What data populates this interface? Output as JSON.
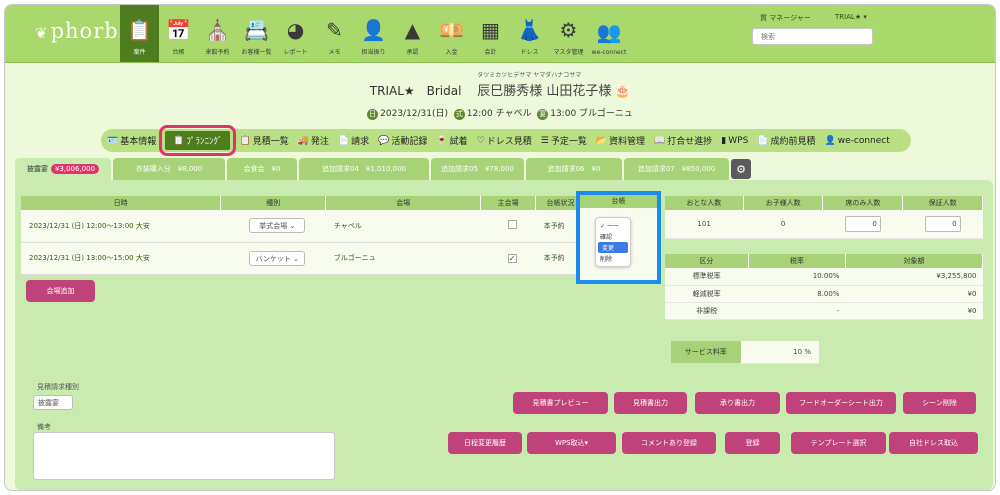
{
  "brand": {
    "logo": "phorbs",
    "sprig": "❦"
  },
  "nav": [
    {
      "icon": "📋",
      "label": "案件",
      "name": "nav-case",
      "active": true
    },
    {
      "icon": "📅",
      "label": "台帳",
      "name": "nav-ledger"
    },
    {
      "icon": "⛪",
      "label": "来館予約",
      "name": "nav-visit"
    },
    {
      "icon": "📇",
      "label": "お客様一覧",
      "name": "nav-customers"
    },
    {
      "icon": "◕",
      "label": "レポート",
      "name": "nav-report"
    },
    {
      "icon": "✎",
      "label": "メモ",
      "name": "nav-memo"
    },
    {
      "icon": "👤",
      "label": "担当振り",
      "name": "nav-assign"
    },
    {
      "icon": "▲",
      "label": "承認",
      "name": "nav-approve"
    },
    {
      "icon": "💴",
      "label": "入金",
      "name": "nav-payment"
    },
    {
      "icon": "▦",
      "label": "会計",
      "name": "nav-accounting"
    },
    {
      "icon": "👗",
      "label": "ドレス",
      "name": "nav-dress"
    },
    {
      "icon": "⚙",
      "label": "マスタ管理",
      "name": "nav-master"
    },
    {
      "icon": "👥",
      "label": "we-connect",
      "name": "nav-we-connect"
    }
  ],
  "user": {
    "name": "質 マネージャー",
    "trial": "TRIAL★ ▾",
    "search_placeholder": "検索"
  },
  "title": {
    "event": "TRIAL★　Bridal　",
    "names": "辰巳勝秀様 山田花子様",
    "ruby": "タツミカツヒデサマ ヤマダハナコサマ",
    "cake": "🎂"
  },
  "sub": {
    "date_badge": "日",
    "date": "2023/12/31(日)",
    "cer_badge": "式",
    "ceremony": "12:00 チャペル",
    "rec_badge": "宴",
    "reception": "13:00 ブルゴーニュ"
  },
  "menu": [
    {
      "icon": "🪪",
      "label": "基本情報",
      "name": "menu-basic-info"
    },
    {
      "icon": "📋",
      "label": "ﾌﾟﾗﾝﾆﾝｸﾞ",
      "name": "menu-planning",
      "active": true
    },
    {
      "icon": "📋",
      "label": "見積一覧",
      "name": "menu-estimates"
    },
    {
      "icon": "🚚",
      "label": "発注",
      "name": "menu-order"
    },
    {
      "icon": "📄",
      "label": "請求",
      "name": "menu-billing"
    },
    {
      "icon": "💬",
      "label": "活動記録",
      "name": "menu-activity"
    },
    {
      "icon": "🍷",
      "label": "試着",
      "name": "menu-fitting"
    },
    {
      "icon": "♡",
      "label": "ドレス見積",
      "name": "menu-dress-estimate"
    },
    {
      "icon": "☰",
      "label": "予定一覧",
      "name": "menu-schedule"
    },
    {
      "icon": "📂",
      "label": "資料管理",
      "name": "menu-documents"
    },
    {
      "icon": "📖",
      "label": "打合せ進捗",
      "name": "menu-meeting"
    },
    {
      "icon": "▮",
      "label": "WPS",
      "name": "menu-wps"
    },
    {
      "icon": "📄",
      "label": "成約前見積",
      "name": "menu-pre-contract"
    },
    {
      "icon": "👤",
      "label": "we-connect",
      "name": "menu-we-connect"
    }
  ],
  "tabs": [
    {
      "label": "披露宴",
      "amount": "¥3,006,000",
      "w": 96,
      "active": true
    },
    {
      "label": "衣装購入分　¥8,000",
      "w": 112
    },
    {
      "label": "会食会　¥0",
      "w": 70
    },
    {
      "label": "追加請求04　¥1,010,000",
      "w": 130
    },
    {
      "label": "追加請求05　¥78,000",
      "w": 93
    },
    {
      "label": "追加請求06　¥0",
      "w": 96
    },
    {
      "label": "追加請求07　¥850,000",
      "w": 105
    }
  ],
  "venue": {
    "headers": [
      "日時",
      "種別",
      "会場",
      "主会場",
      "台帳状況",
      "台帳"
    ],
    "rows": [
      {
        "datetime": "2023/12/31 (日) 12:00〜13:00 大安",
        "type": "挙式会場",
        "venue": "チャペル",
        "main": "",
        "status": "本予約"
      },
      {
        "datetime": "2023/12/31 (日) 13:00〜15:00 大安",
        "type": "バンケット",
        "venue": "ブルゴーニュ",
        "main": "✓",
        "status": "本予約"
      }
    ],
    "add_button": "会場追加"
  },
  "dropdown": {
    "options": [
      "✓ ーー",
      "確認",
      "変更",
      "削除"
    ],
    "selected": "変更"
  },
  "guests": {
    "headers": [
      "おとな人数",
      "お子様人数",
      "席のみ人数",
      "保証人数"
    ],
    "values": [
      "101",
      "0",
      "0",
      "0"
    ]
  },
  "tax": {
    "headers": [
      "区分",
      "税率",
      "対象額"
    ],
    "rows": [
      [
        "標準税率",
        "10.00%",
        "¥3,255,800"
      ],
      [
        "軽減税率",
        "8.00%",
        "¥0"
      ],
      [
        "非課税",
        "-",
        "¥0"
      ]
    ]
  },
  "service": {
    "label": "サービス料率",
    "value": "10 %"
  },
  "bottom": {
    "estimate_type_label": "見積請求種別",
    "estimate_type_value": "披露宴",
    "notes_label": "備考",
    "buttons_row1": [
      "見積書プレビュー",
      "見積書出力",
      "承り書出力",
      "フードオーダーシート出力",
      "シーン削除"
    ],
    "buttons_row2": [
      "日程変更履歴",
      "WPS取込▾",
      "コメントあり登録",
      "登録",
      "テンプレート選択",
      "自社ドレス取込"
    ]
  },
  "colors": {
    "accent": "#a9d86c",
    "nav_active": "#4d7d1f",
    "pink": "#c0427a",
    "highlight": "#1a8cf0"
  }
}
